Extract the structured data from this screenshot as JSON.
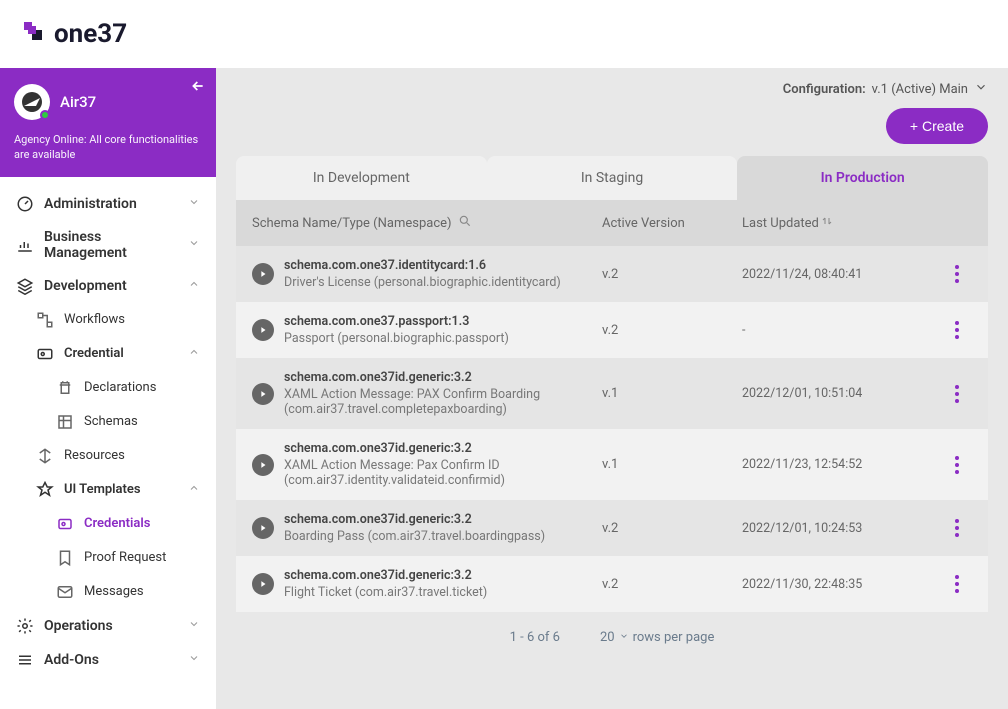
{
  "brand": "one37",
  "agency": {
    "name": "Air37",
    "status": "Agency Online: All core functionalities are available"
  },
  "nav": {
    "administration": "Administration",
    "business": "Business Management",
    "development": "Development",
    "workflows": "Workflows",
    "credential": "Credential",
    "declarations": "Declarations",
    "schemas": "Schemas",
    "resources": "Resources",
    "ui_templates": "UI Templates",
    "credentials": "Credentials",
    "proof_request": "Proof Request",
    "messages": "Messages",
    "operations": "Operations",
    "addons": "Add-Ons"
  },
  "config": {
    "label": "Configuration:",
    "value": "v.1 (Active) Main"
  },
  "create_label": "+ Create",
  "tabs": {
    "dev": "In Development",
    "staging": "In Staging",
    "prod": "In Production"
  },
  "columns": {
    "name": "Schema Name/Type (Namespace)",
    "version": "Active Version",
    "updated": "Last Updated"
  },
  "rows": [
    {
      "schema": "schema.com.one37.identitycard:1.6",
      "desc": "Driver's License (personal.biographic.identitycard)",
      "version": "v.2",
      "updated": "2022/11/24, 08:40:41"
    },
    {
      "schema": "schema.com.one37.passport:1.3",
      "desc": "Passport (personal.biographic.passport)",
      "version": "v.2",
      "updated": "-"
    },
    {
      "schema": "schema.com.one37id.generic:3.2",
      "desc": "XAML Action Message: PAX Confirm Boarding (com.air37.travel.completepaxboarding)",
      "version": "v.1",
      "updated": "2022/12/01, 10:51:04"
    },
    {
      "schema": "schema.com.one37id.generic:3.2",
      "desc": "XAML Action Message: Pax Confirm ID (com.air37.identity.validateid.confirmid)",
      "version": "v.1",
      "updated": "2022/11/23, 12:54:52"
    },
    {
      "schema": "schema.com.one37id.generic:3.2",
      "desc": "Boarding Pass (com.air37.travel.boardingpass)",
      "version": "v.2",
      "updated": "2022/12/01, 10:24:53"
    },
    {
      "schema": "schema.com.one37id.generic:3.2",
      "desc": "Flight Ticket (com.air37.travel.ticket)",
      "version": "v.2",
      "updated": "2022/11/30, 22:48:35"
    }
  ],
  "pagination": {
    "info": "1 - 6 of 6",
    "rows_count": "20",
    "rows_label": "rows per page"
  }
}
